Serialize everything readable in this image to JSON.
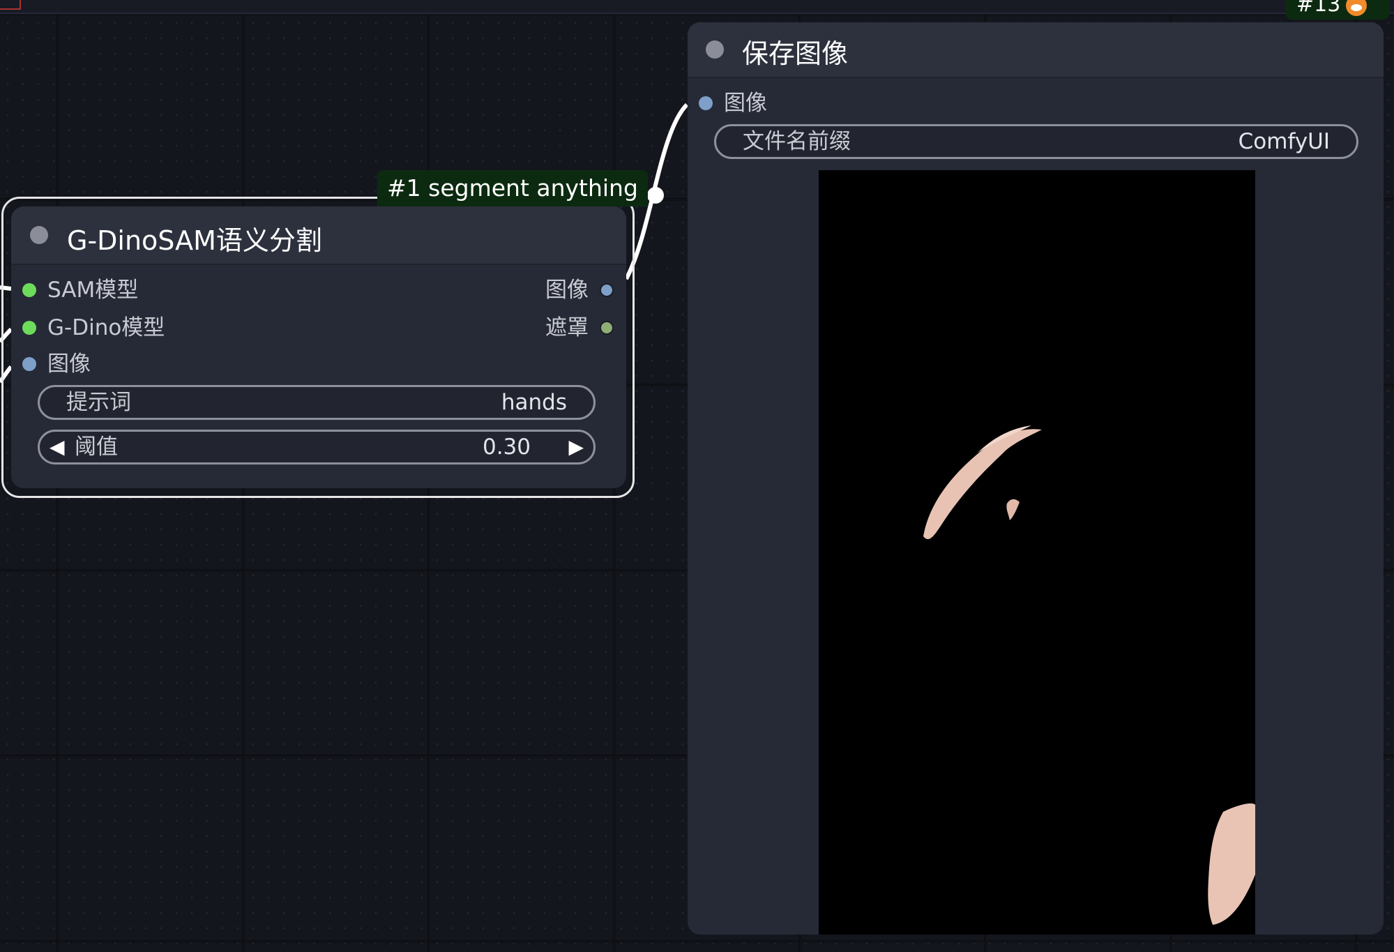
{
  "node_segment": {
    "badge": "#1 segment anything",
    "title": "G-DinoSAM语义分割",
    "inputs": [
      {
        "label": "SAM模型",
        "color": "#6ddc5a"
      },
      {
        "label": "G-Dino模型",
        "color": "#6ddc5a"
      },
      {
        "label": "图像",
        "color": "#7ea0c8"
      }
    ],
    "outputs": [
      {
        "label": "图像",
        "color": "#7ea0c8"
      },
      {
        "label": "遮罩",
        "color": "#8fae76"
      }
    ],
    "prompt_widget": {
      "label": "提示词",
      "value": "hands"
    },
    "threshold_widget": {
      "label": "阈值",
      "value": "0.30",
      "left_arrow": "◀",
      "right_arrow": "▶"
    }
  },
  "node_save": {
    "badge": "#13",
    "badge_icon": "fox-icon",
    "title": "保存图像",
    "inputs": [
      {
        "label": "图像",
        "color": "#7ea0c8"
      }
    ],
    "filename_widget": {
      "label": "文件名前缀",
      "value": "ComfyUI"
    },
    "preview_background": "#000000"
  },
  "colors": {
    "canvas": "#14161d",
    "node_body": "#262a36",
    "node_header": "#2d313d",
    "badge_bg": "#0c2a10",
    "selection_outline": "#e6e6e6"
  }
}
